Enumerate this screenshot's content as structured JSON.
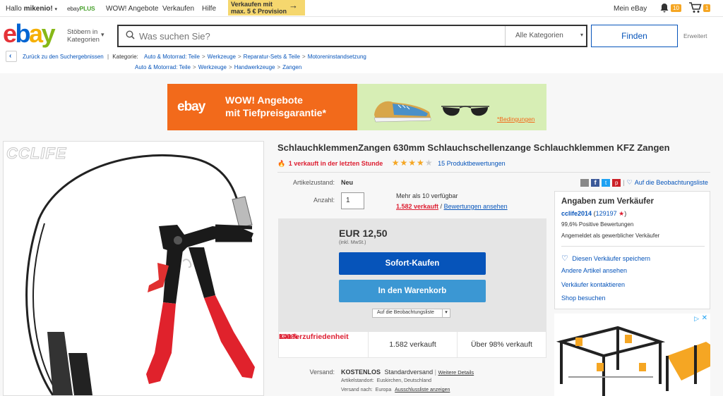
{
  "topbar": {
    "greeting_prefix": "Hallo ",
    "greeting_user": "mikenio!",
    "ebay_plus": "ebayPLUS",
    "wow": "WOW! Angebote",
    "verkaufen": "Verkaufen",
    "hilfe": "Hilfe",
    "promo_line1": "Verkaufen mit",
    "promo_line2": "max. 5 € Provision",
    "mein_ebay": "Mein eBay",
    "notif_count": "10",
    "cart_count": "1"
  },
  "header": {
    "browse_line1": "Stöbern in",
    "browse_line2": "Kategorien",
    "search_placeholder": "Was suchen Sie?",
    "category_select": "Alle Kategorien",
    "find_button": "Finden",
    "advanced": "Erweitert"
  },
  "breadcrumb": {
    "back": "Zurück zu den Suchergebnissen",
    "category_label": "Kategorie:",
    "path1": [
      "Auto & Motorrad: Teile",
      "Werkzeuge",
      "Reparatur-Sets & Teile",
      "Motoreninstandsetzung"
    ],
    "path2": [
      "Auto & Motorrad: Teile",
      "Werkzeuge",
      "Handwerkzeuge",
      "Zangen"
    ]
  },
  "banner": {
    "logo": "ebay",
    "line1": "WOW! Angebote",
    "line2": "mit Tiefpreisgarantie*",
    "conditions": "*Bedingungen"
  },
  "gallery": {
    "watermark": "CCLIFE"
  },
  "item": {
    "title": "SchlauchklemmenZangen 630mm Schlauchschellenzange Schlauchklemmen KFZ Zangen",
    "sold_recent": "1 verkauft in der letzten Stunde",
    "rating_stars": 4,
    "reviews": "15 Produktbewertungen",
    "condition_label": "Artikelzustand:",
    "condition_value": "Neu",
    "qty_label": "Anzahl:",
    "qty_value": "1",
    "available": "Mehr als 10 verfügbar",
    "sold_link": "1.582 verkauft",
    "reviews_link": "Bewertungen ansehen",
    "price": "EUR 12,50",
    "vat": "(inkl. MwSt.)",
    "buy_now": "Sofort-Kaufen",
    "add_to_cart": "In den Warenkorb",
    "watch": "Auf die Beobachtungsliste",
    "stat_satisfaction_pct": "100%",
    "stat_satisfaction_label": "Käuferzufriedenheit",
    "stat_sold": "1.582 verkauft",
    "stat_over": "Über 98% verkauft",
    "shipping_label": "Versand:",
    "shipping_free": "KOSTENLOS",
    "shipping_type": "Standardversand",
    "shipping_details": "Weitere Details",
    "location": "Artikelstandort:  Euskirchen, Deutschland",
    "ships_to_prefix": "Versand nach:  Europa",
    "ships_to_link": "Ausschlussliste anzeigen"
  },
  "share": {
    "watchlist": "Auf die Beobachtungsliste"
  },
  "seller": {
    "heading": "Angaben zum Verkäufer",
    "name": "cclife2014",
    "score": "129197",
    "positive": "99,6% Positive Bewertungen",
    "type": "Angemeldet als gewerblicher Verkäufer",
    "save": "Diesen Verkäufer speichern",
    "other_items": "Andere Artikel ansehen",
    "contact": "Verkäufer kontaktieren",
    "shop": "Shop besuchen"
  },
  "colors": {
    "accent": "#0654ba",
    "buy_now": "#0654ba",
    "cart": "#3b97d3",
    "banner_orange": "#f26a1b",
    "banner_green": "#d7eeb5",
    "hot": "#dd1e31"
  }
}
